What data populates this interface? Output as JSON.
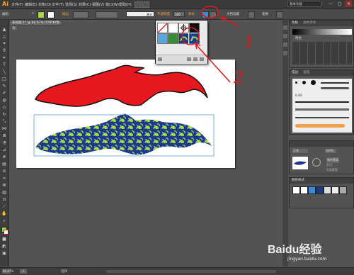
{
  "app": {
    "logo": "Ai"
  },
  "menu": [
    "文件(F)",
    "编辑(E)",
    "对象(O)",
    "文字(T)",
    "选择(S)",
    "效果(C)",
    "视图(V)",
    "窗口(W)",
    "帮助(H)"
  ],
  "workspace": "基本功能",
  "window_controls": [
    "—",
    "□",
    "✕"
  ],
  "control_bar": {
    "object_label": "编组",
    "stroke_label": "描边",
    "stroke_style": "基本",
    "opacity_label": "不透明度",
    "opacity_value": "100",
    "style_label": "样式",
    "doc_settings": "文档设置",
    "transform": "变换"
  },
  "tab": {
    "title": "未标题-1* @ 66.67% (CMYK/预览)"
  },
  "popup": {
    "swatches": [
      "none",
      "white",
      "registration",
      "black",
      "blue-pattern",
      "green-pattern",
      "pattern-selected"
    ],
    "footer_icons": [
      "library-icon",
      "folder-icon",
      "new-swatch-icon",
      "trash-icon"
    ]
  },
  "right_panels": {
    "color_guide_tabs": [
      "色板",
      "颜色参考"
    ],
    "color_guide_label": "暗色",
    "stroke_tabs": [
      "描边",
      "画笔"
    ],
    "brush_size": "6.00",
    "stroke_tab2": [
      "描边"
    ],
    "transparency_blend": "正常",
    "transparency_opacity": "100%",
    "mask_btn": "制作蒙版",
    "clip_label": "剪切",
    "invert_label": "反相蒙版",
    "graphic_styles_tab": "图形样式"
  },
  "status": {
    "zoom": "66.67%",
    "page": "1",
    "tool": "选择"
  },
  "annotations": {
    "first": "1",
    "second": "2"
  },
  "watermark": {
    "brand": "Baidu经验",
    "url": "jingyan.baidu.com"
  },
  "colors": {
    "red": "#e6171e",
    "pattern_blue": "#1c3a8a",
    "pattern_green": "#a8d844",
    "accent_orange": "#f7a21b",
    "annotation_red": "#e0191c"
  }
}
